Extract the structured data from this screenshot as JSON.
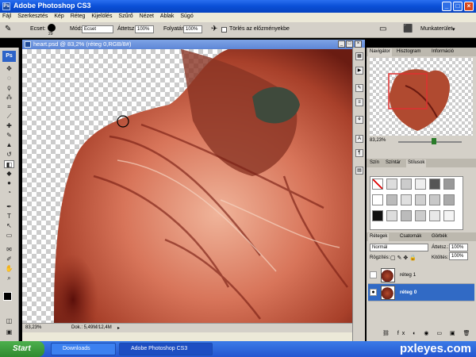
{
  "window": {
    "title": "Adobe Photoshop CS3"
  },
  "menu": [
    "Fájl",
    "Szerkesztés",
    "Kép",
    "Réteg",
    "Kijelölés",
    "Szűrő",
    "Nézet",
    "Ablak",
    "Súgó"
  ],
  "options": {
    "brush_label": "Ecset:",
    "brush_size": "29",
    "mode_label": "Mód:",
    "mode_value": "Ecset",
    "opacity_label": "Áttetsz.:",
    "opacity_value": "100%",
    "flow_label": "Folyatás:",
    "flow_value": "100%",
    "history_checkbox": "Törlés az előzményekbe",
    "workspace": "Munkaterület"
  },
  "document": {
    "title": "heart.psd @ 83,2% (réteg 0,RGB/8#)",
    "zoom": "83,23%",
    "doc_size": "Dok.: 5,49M/12,4M"
  },
  "navigator": {
    "tabs": [
      "Navigátor",
      "Hisztogram",
      "Információ"
    ],
    "zoom": "83,23%"
  },
  "styles": {
    "tabs": [
      "Szín",
      "Színtár",
      "Stílusok"
    ]
  },
  "layers": {
    "tabs": [
      "Rétegek",
      "Csatornák",
      "Görbék"
    ],
    "blend_mode": "Normál",
    "opacity_label": "Áttetsz.:",
    "opacity_value": "100%",
    "lock_label": "Rögzítés:",
    "fill_label": "Kitöltés:",
    "fill_value": "100%",
    "items": [
      {
        "name": "réteg 1",
        "selected": false
      },
      {
        "name": "réteg 0",
        "selected": true
      }
    ]
  },
  "taskbar": {
    "start": "Start",
    "tasks": [
      "Downloads",
      "Adobe Photoshop CS3"
    ]
  },
  "watermark": "pxleyes.com",
  "colors": {
    "selection": "#316ac5",
    "title_blue": "#0a4fd6",
    "start_green": "#3a9a3a"
  }
}
